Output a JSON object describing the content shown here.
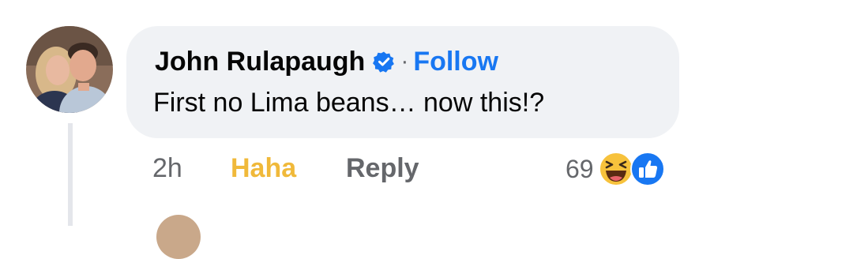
{
  "comment": {
    "author": "John Rulapaugh",
    "separator": "·",
    "follow_label": "Follow",
    "text": "First no Lima beans… now this!?",
    "time": "2h",
    "reaction_action_label": "Haha",
    "reply_label": "Reply",
    "reaction_count": "69",
    "reactions": [
      "haha-icon",
      "like-icon"
    ],
    "verified_icon": "verified-badge-icon"
  },
  "colors": {
    "bubble_bg": "#f0f2f5",
    "link_blue": "#1877f2",
    "haha_yellow": "#f0b93a",
    "muted_text": "#65676b",
    "primary_text": "#050505"
  }
}
